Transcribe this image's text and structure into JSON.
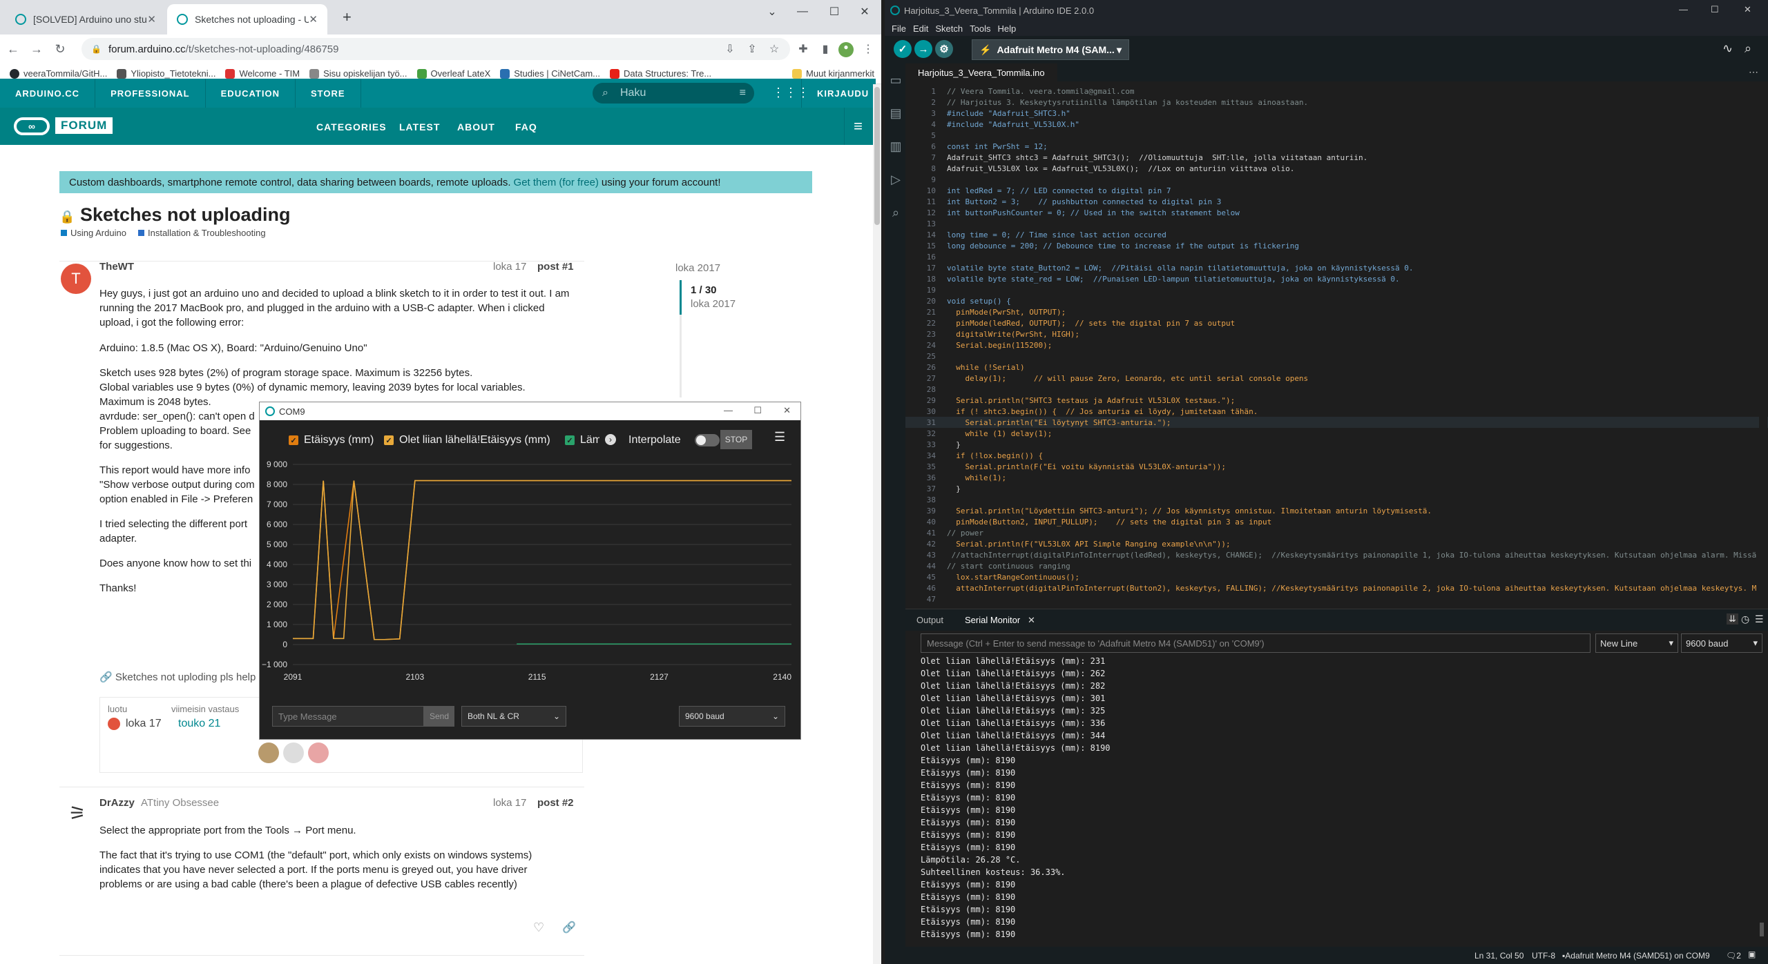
{
  "browser": {
    "tabs": [
      {
        "label": "[SOLVED] Arduino uno stuck on ⁠'"
      },
      {
        "label": "Sketches not uploading - Using A"
      }
    ],
    "url_host": "forum.arduino.cc",
    "url_path": "/t/sketches-not-uploading/486759",
    "bookmarks": [
      {
        "label": "veeraTommila/GitH..."
      },
      {
        "label": "Yliopisto_Tietotekni..."
      },
      {
        "label": "Welcome - TIM"
      },
      {
        "label": "Sisu opiskelijan työ..."
      },
      {
        "label": "Overleaf LateX"
      },
      {
        "label": "Studies | CiNetCam..."
      },
      {
        "label": "Data Structures: Tre..."
      }
    ],
    "bookmarks_other": "Muut kirjanmerkit"
  },
  "forum": {
    "nav": [
      "ARDUINO.CC",
      "PROFESSIONAL",
      "EDUCATION",
      "STORE"
    ],
    "search_placeholder": "Haku",
    "login": "KIRJAUDU",
    "logo_text": "FORUM",
    "menu": [
      "CATEGORIES",
      "LATEST",
      "ABOUT",
      "FAQ"
    ],
    "banner_text": "Custom dashboards, smartphone remote control, data sharing between boards, remote uploads.",
    "banner_link": "Get them (for free)",
    "banner_tail": "using your forum account!",
    "topic_title": "Sketches not uploading",
    "categories": [
      "Using Arduino",
      "Installation & Troubleshooting"
    ],
    "post1": {
      "author": "TheWT",
      "avatar_letter": "T",
      "date": "loka 17",
      "num": "post #1",
      "p1": "Hey guys, i just got an arduino uno and decided to upload a blink sketch to it in order to test it out. I am running the 2017 MacBook pro, and plugged in the arduino with a USB-C adapter. When i clicked upload, i got the following error:",
      "p2": "Arduino: 1.8.5 (Mac OS X), Board: \"Arduino/Genuino Uno\"",
      "p3a": "Sketch uses 928 bytes (2%) of program storage space. Maximum is 32256 bytes.",
      "p3b": "Global variables use 9 bytes (0%) of dynamic memory, leaving 2039 bytes for local variables.",
      "p3c": "Maximum is 2048 bytes.",
      "p3d": "avrdude: ser_open(): can't open d",
      "p3e": "Problem uploading to board. See",
      "p3f": "for suggestions.",
      "p4a": "This report would have more info",
      "p4b": "\"Show verbose output during com",
      "p4c": "option enabled in File -> Preferen",
      "p5a": "I tried selecting the different port",
      "p5b": "adapter.",
      "p6": "Does anyone know how to set thi",
      "p7": "Thanks!",
      "link": "Sketches not upl",
      "link_tail": "oding pls help"
    },
    "meta": {
      "created_label": "luotu",
      "created": "loka 17",
      "reply_label": "viimeisin vastaus",
      "reply": "touko 21"
    },
    "timeline": {
      "top": "loka 2017",
      "count": "1 / 30",
      "date": "loka 2017"
    },
    "post2": {
      "author": "DrAzzy",
      "title": "ATtiny Obsessee",
      "date": "loka 17",
      "num": "post #2",
      "p1": "Select the appropriate port from the Tools → Port menu.",
      "p2": "The fact that it's trying to use COM1 (the \"default\" port, which only exists on windows systems) indicates that you have never selected a port. If the ports menu is greyed out, you have driver problems or are using a bad cable (there's been a plague of defective USB cables recently)"
    }
  },
  "plotter": {
    "title": "COM9",
    "legend": [
      "Etäisyys (mm)",
      "Olet liian lähellä!Etäisyys (mm)",
      "Läm"
    ],
    "interpolate": "Interpolate",
    "stop": "STOP",
    "type_placeholder": "Type Message",
    "send": "Send",
    "line_ending": "Both NL & CR",
    "baud": "9600 baud"
  },
  "chart_data": {
    "type": "line",
    "x_ticks": [
      "2091",
      "2103",
      "2115",
      "2127",
      "2140"
    ],
    "y_ticks": [
      "9 000",
      "8 000",
      "7 000",
      "6 000",
      "5 000",
      "4 000",
      "3 000",
      "2 000",
      "1 000",
      "0",
      "−1 000"
    ],
    "ylim": [
      -1000,
      9000
    ],
    "xlim": [
      2091,
      2140
    ],
    "series": [
      {
        "name": "Etäisyys (mm)",
        "color": "#e07d10",
        "x": [
          2091,
          2093,
          2094,
          2095,
          2097,
          2099,
          2100,
          2101.5,
          2103,
          2104,
          2110,
          2120,
          2130,
          2140
        ],
        "values": [
          300,
          300,
          8190,
          300,
          8190,
          250,
          250,
          280,
          8190,
          8190,
          8190,
          8190,
          8190,
          8190
        ]
      },
      {
        "name": "Olet liian lähellä!Etäisyys (mm)",
        "color": "#e8a93a",
        "x": [
          2091,
          2093,
          2094,
          2095,
          2096,
          2097,
          2099,
          2100,
          2101.5,
          2103,
          2104,
          2140
        ],
        "values": [
          300,
          300,
          8190,
          300,
          300,
          8190,
          250,
          250,
          280,
          8190,
          8190,
          8190
        ]
      },
      {
        "name": "Läm",
        "color": "#2aa36b",
        "x": [
          2113,
          2140
        ],
        "values": [
          26.28,
          26.28
        ]
      }
    ]
  },
  "ide": {
    "title": "Harjoitus_3_Veera_Tommila | Arduino IDE 2.0.0",
    "menu": [
      "File",
      "Edit",
      "Sketch",
      "Tools",
      "Help"
    ],
    "board": "Adafruit Metro M4 (SAM...",
    "file_tab": "Harjoitus_3_Veera_Tommila.ino",
    "code": [
      "// Veera Tommila. veera.tommila@gmail.com",
      "// Harjoitus 3. Keskeytysrutiinilla lämpötilan ja kosteuden mittaus ainoastaan.",
      "#include \"Adafruit_SHTC3.h\"",
      "#include \"Adafruit_VL53L0X.h\"",
      "",
      "const int PwrSht = 12;",
      "Adafruit_SHTC3 shtc3 = Adafruit_SHTC3();  //Oliomuuttuja  SHT:lle, jolla viitataan anturiin.",
      "Adafruit_VL53L0X lox = Adafruit_VL53L0X();  //Lox on anturiin viittava olio.",
      "",
      "int ledRed = 7; // LED connected to digital pin 7",
      "int Button2 = 3;    // pushbutton connected to digital pin 3",
      "int buttonPushCounter = 0; // Used in the switch statement below",
      "",
      "long time = 0; // Time since last action occured",
      "long debounce = 200; // Debounce time to increase if the output is flickering",
      "",
      "volatile byte state_Button2 = LOW;  //Pitäisi olla napin tilatietomuuttuja, joka on käynnistyksessä 0.",
      "volatile byte state_red = LOW;  //Punaisen LED-lampun tilatietomuuttuja, joka on käynnistyksessä 0.",
      "",
      "void setup() {",
      "  pinMode(PwrSht, OUTPUT);",
      "  pinMode(ledRed, OUTPUT);  // sets the digital pin 7 as output",
      "  digitalWrite(PwrSht, HIGH);",
      "  Serial.begin(115200);",
      "",
      "  while (!Serial)",
      "    delay(1);      // will pause Zero, Leonardo, etc until serial console opens",
      "",
      "  Serial.println(\"SHTC3 testaus ja Adafruit VL53L0X testaus.\");",
      "  if (! shtc3.begin()) {  // Jos anturia ei löydy, jumitetaan tähän.",
      "    Serial.println(\"Ei löytynyt SHTC3-anturia.\");",
      "    while (1) delay(1);",
      "  }",
      "  if (!lox.begin()) {",
      "    Serial.println(F(\"Ei voitu käynnistää VL53L0X-anturia\"));",
      "    while(1);",
      "  }",
      "",
      "  Serial.println(\"Löydettiin SHTC3-anturi\"); // Jos käynnistys onnistuu. Ilmoitetaan anturin löytymisestä.",
      "  pinMode(Button2, INPUT_PULLUP);    // sets the digital pin 3 as input",
      "// power",
      "  Serial.println(F(\"VL53L0X API Simple Ranging example\\n\\n\"));",
      " //attachInterrupt(digitalPinToInterrupt(ledRed), keskeytys, CHANGE);  //Keskeytysmääritys painonapille 1, joka IO-tulona aiheuttaa keskeytyksen. Kutsutaan ohjelmaa alarm. Missä",
      "// start continuous ranging",
      "  lox.startRangeContinuous();",
      "  attachInterrupt(digitalPinToInterrupt(Button2), keskeytys, FALLING); //Keskeytysmääritys painonapille 2, joka IO-tulona aiheuttaa keskeytyksen. Kutsutaan ohjelmaa keskeytys. M",
      ""
    ],
    "panel_tabs": [
      "Output",
      "Serial Monitor"
    ],
    "serial_placeholder": "Message (Ctrl + Enter to send message to 'Adafruit Metro M4 (SAMD51)' on 'COM9')",
    "line_ending": "New Line",
    "baud": "9600 baud",
    "serial_lines": [
      "Olet liian lähellä!Etäisyys (mm): 231",
      "Olet liian lähellä!Etäisyys (mm): 262",
      "Olet liian lähellä!Etäisyys (mm): 282",
      "Olet liian lähellä!Etäisyys (mm): 301",
      "Olet liian lähellä!Etäisyys (mm): 325",
      "Olet liian lähellä!Etäisyys (mm): 336",
      "Olet liian lähellä!Etäisyys (mm): 344",
      "Olet liian lähellä!Etäisyys (mm): 8190",
      "Etäisyys (mm): 8190",
      "Etäisyys (mm): 8190",
      "Etäisyys (mm): 8190",
      "Etäisyys (mm): 8190",
      "Etäisyys (mm): 8190",
      "Etäisyys (mm): 8190",
      "Etäisyys (mm): 8190",
      "Etäisyys (mm): 8190",
      "Lämpötila: 26.28 °C.",
      "Suhteellinen kosteus: 36.33%.",
      "Etäisyys (mm): 8190",
      "Etäisyys (mm): 8190",
      "Etäisyys (mm): 8190",
      "Etäisyys (mm): 8190",
      "Etäisyys (mm): 8190"
    ],
    "status": {
      "position": "Ln 31, Col 50",
      "encoding": "UTF-8",
      "board": "Adafruit Metro M4 (SAMD51) on COM9",
      "notifications": "2"
    }
  }
}
